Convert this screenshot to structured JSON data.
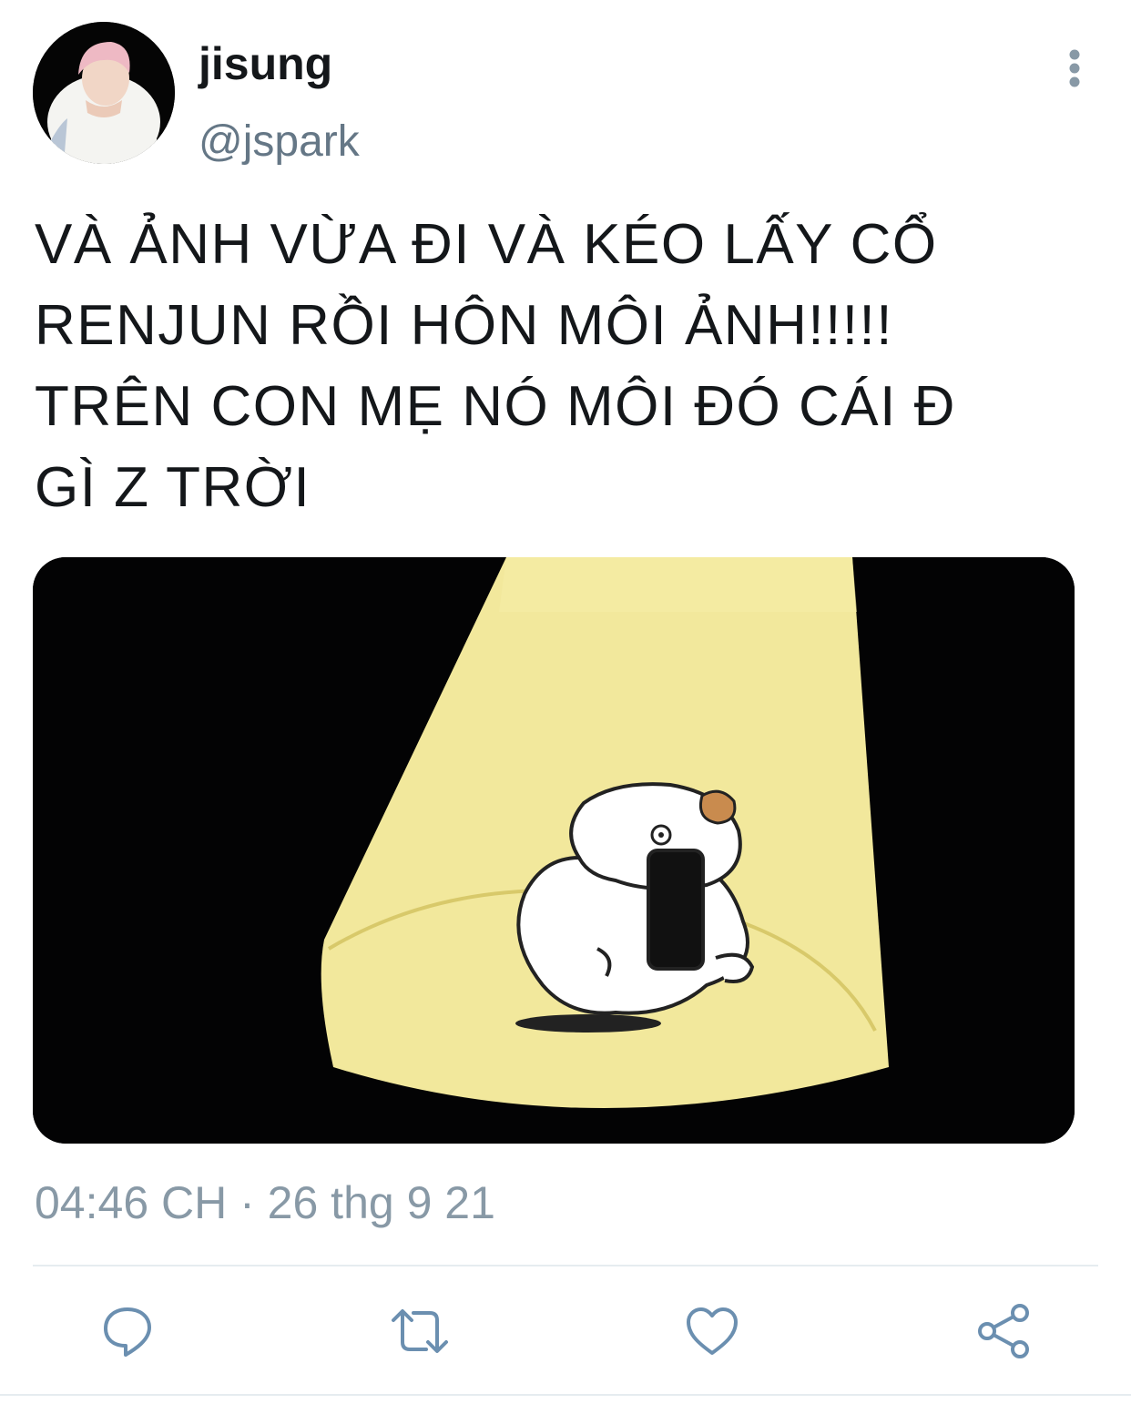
{
  "tweet": {
    "display_name": "jisung",
    "handle": "@jspark",
    "text": "VÀ ẢNH VỪA ĐI VÀ KÉO LẤY CỔ\nRENJUN RỒI HÔN MÔI ẢNH!!!!!\nTRÊN CON MẸ NÓ MÔI ĐÓ CÁI Đ\nGÌ Z TRỜI",
    "timestamp": "04:46 CH · 26 thg 9 21"
  },
  "icons": {
    "more": "more-vertical-icon",
    "reply": "speech-bubble-icon",
    "retweet": "retweet-icon",
    "like": "heart-icon",
    "share": "share-icon"
  },
  "colors": {
    "text": "#14171a",
    "secondary": "#657786",
    "muted": "#8899a6",
    "icon": "#6b8fb0",
    "divider": "#e6ecf0",
    "spotlight": "#f2e89c"
  }
}
